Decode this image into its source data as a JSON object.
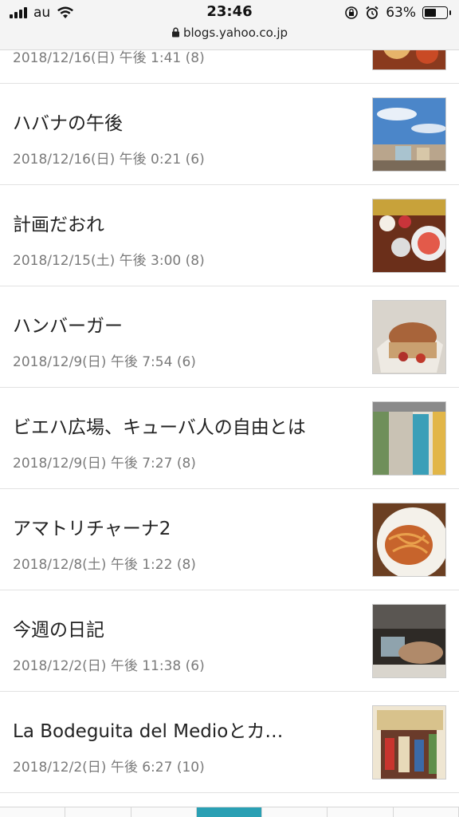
{
  "status": {
    "carrier": "au",
    "time": "23:46",
    "battery": "63%",
    "battery_level": 0.63,
    "url": "blogs.yahoo.co.jp"
  },
  "posts": [
    {
      "title": "",
      "meta": "2018/12/16(日) 午後 1:41 (8)",
      "thumb": "food-thumb"
    },
    {
      "title": "ハバナの午後",
      "meta": "2018/12/16(日) 午後 0:21 (6)",
      "thumb": "sky-buildings-thumb"
    },
    {
      "title": "計画だおれ",
      "meta": "2018/12/15(土) 午後 3:00 (8)",
      "thumb": "table-food-thumb"
    },
    {
      "title": "ハンバーガー",
      "meta": "2018/12/9(日) 午後 7:54 (6)",
      "thumb": "burger-thumb"
    },
    {
      "title": "ビエハ広場、キューバ人の自由とは",
      "meta": "2018/12/9(日) 午後 7:27 (8)",
      "thumb": "street-thumb"
    },
    {
      "title": "アマトリチャーナ2",
      "meta": "2018/12/8(土) 午後 1:22 (8)",
      "thumb": "pasta-thumb"
    },
    {
      "title": "今週の日記",
      "meta": "2018/12/2(日) 午後 11:38 (6)",
      "thumb": "cafe-thumb"
    },
    {
      "title": "La Bodeguita del Medioとカ…",
      "meta": "2018/12/2(日) 午後 6:27 (10)",
      "thumb": "bar-thumb"
    }
  ],
  "colors": {
    "tab_active": "#2aa0b4"
  }
}
